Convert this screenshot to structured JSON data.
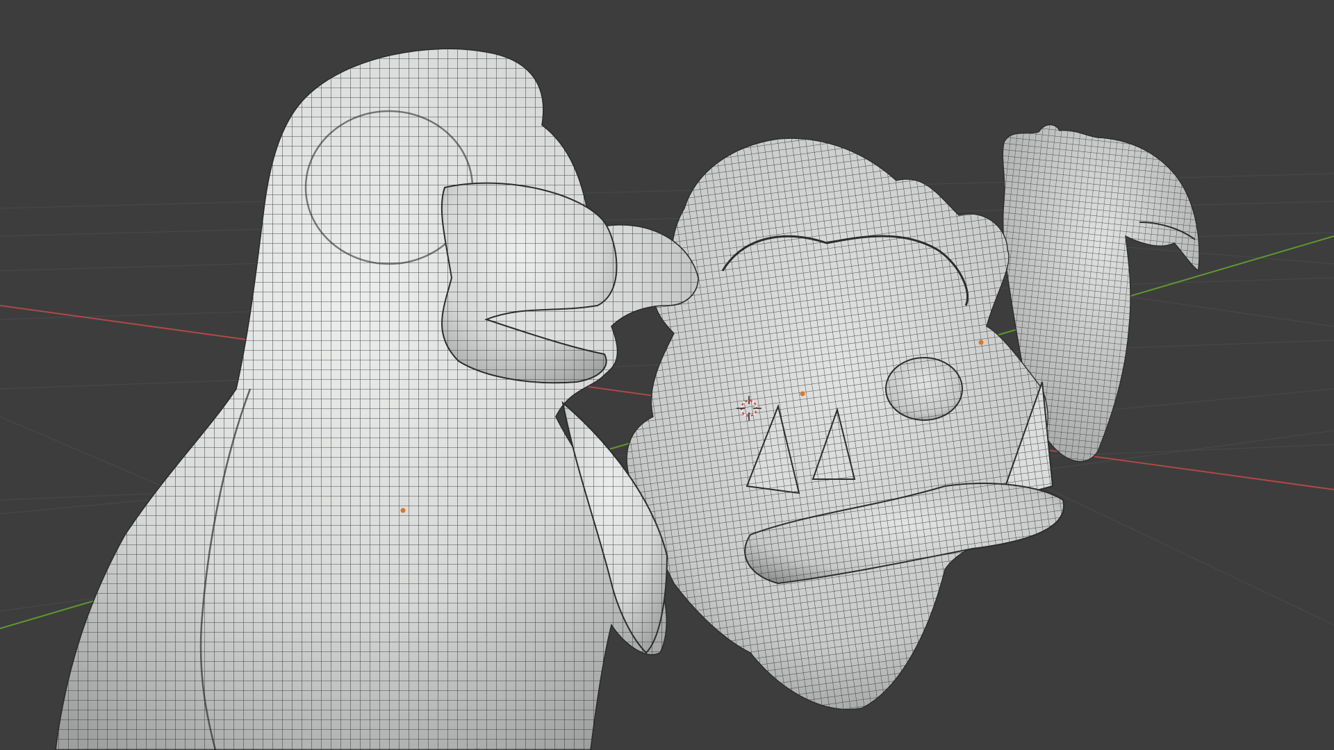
{
  "viewport": {
    "background_color": "#3d3d3d",
    "grid_color": "#4a4a4a",
    "x_axis_color": "#b04848",
    "y_axis_color": "#5e9a2e",
    "mesh_fill_color": "#d9dbda",
    "mesh_wire_color": "#2c2c2c",
    "origin_point_color": "#e0751e",
    "view": "perspective"
  },
  "scene": {
    "objects": [
      {
        "name_icon": "penguin-mesh",
        "kind": "sculpted mesh with quad wireframe"
      },
      {
        "name_icon": "ogre-head-mesh",
        "kind": "sculpted mesh with quad wireframe"
      },
      {
        "name_icon": "bird-mesh",
        "kind": "sculpted mesh with quad wireframe"
      }
    ],
    "cursor_icon": "3d-cursor-icon"
  }
}
